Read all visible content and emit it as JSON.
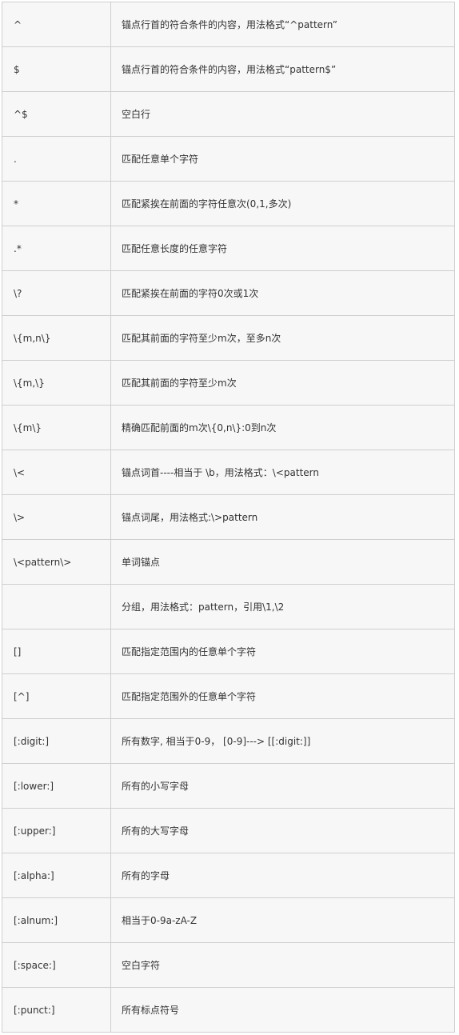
{
  "table": {
    "rows": [
      {
        "pattern": "^",
        "description": "锚点行首的符合条件的内容，用法格式“^pattern”"
      },
      {
        "pattern": "$",
        "description": "锚点行首的符合条件的内容，用法格式“pattern$”"
      },
      {
        "pattern": "^$",
        "description": "空白行"
      },
      {
        "pattern": ".",
        "description": "匹配任意单个字符"
      },
      {
        "pattern": "*",
        "description": "匹配紧挨在前面的字符任意次(0,1,多次)"
      },
      {
        "pattern": ".*",
        "description": "匹配任意长度的任意字符"
      },
      {
        "pattern": "\\?",
        "description": "匹配紧挨在前面的字符0次或1次"
      },
      {
        "pattern": "\\{m,n\\}",
        "description": "匹配其前面的字符至少m次，至多n次"
      },
      {
        "pattern": "\\{m,\\}",
        "description": "匹配其前面的字符至少m次"
      },
      {
        "pattern": "\\{m\\}",
        "description": "精确匹配前面的m次\\{0,n\\}:0到n次"
      },
      {
        "pattern": "\\<",
        "description": "锚点词首----相当于 \\b，用法格式：\\<pattern"
      },
      {
        "pattern": "\\>",
        "description": "锚点词尾，用法格式:\\>pattern"
      },
      {
        "pattern": "\\<pattern\\>",
        "description": "单词锚点"
      },
      {
        "pattern": "",
        "description": "分组，用法格式：pattern，引用\\1,\\2"
      },
      {
        "pattern": "[]",
        "description": "匹配指定范围内的任意单个字符"
      },
      {
        "pattern": "[^]",
        "description": "匹配指定范围外的任意单个字符"
      },
      {
        "pattern": "[:digit:]",
        "description": "所有数字, 相当于0-9， [0-9]---> [[:digit:]]"
      },
      {
        "pattern": "[:lower:]",
        "description": "所有的小写字母"
      },
      {
        "pattern": "[:upper:]",
        "description": "所有的大写字母"
      },
      {
        "pattern": "[:alpha:]",
        "description": "所有的字母"
      },
      {
        "pattern": "[:alnum:]",
        "description": "相当于0-9a-zA-Z"
      },
      {
        "pattern": "[:space:]",
        "description": "空白字符"
      },
      {
        "pattern": "[:punct:]",
        "description": "所有标点符号"
      }
    ]
  }
}
